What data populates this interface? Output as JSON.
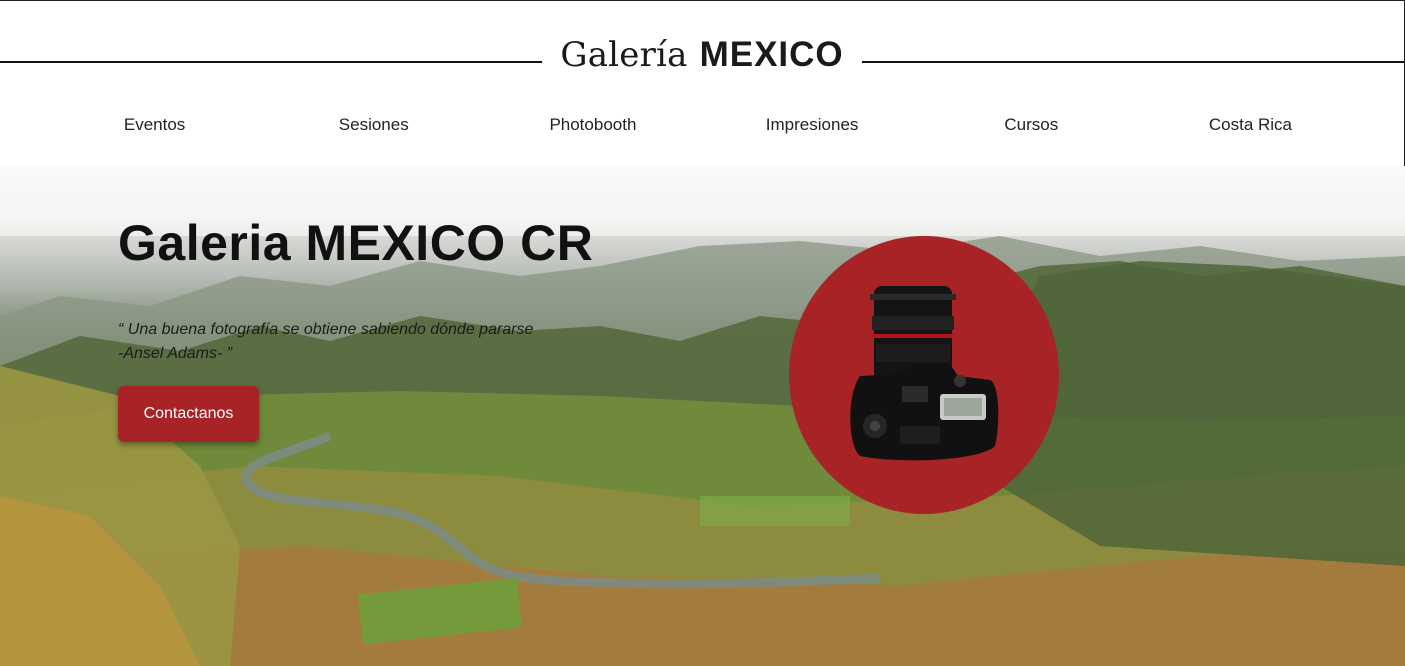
{
  "logo": {
    "script": "Galería",
    "bold": "MEXICO"
  },
  "nav": {
    "items": [
      {
        "label": "Eventos"
      },
      {
        "label": "Sesiones"
      },
      {
        "label": "Photobooth"
      },
      {
        "label": "Impresiones"
      },
      {
        "label": "Cursos"
      },
      {
        "label": "Costa Rica"
      }
    ]
  },
  "hero": {
    "title": "Galeria MEXICO CR",
    "quote_line1": "“ Una buena fotografía se obtiene sabiendo dónde pararse",
    "quote_line2": "-Ansel Adams- ”",
    "cta_label": "Contactanos"
  },
  "colors": {
    "accent": "#a82325",
    "text": "#111111",
    "background": "#ffffff"
  },
  "icons": {
    "hero_image": "camera-icon"
  }
}
